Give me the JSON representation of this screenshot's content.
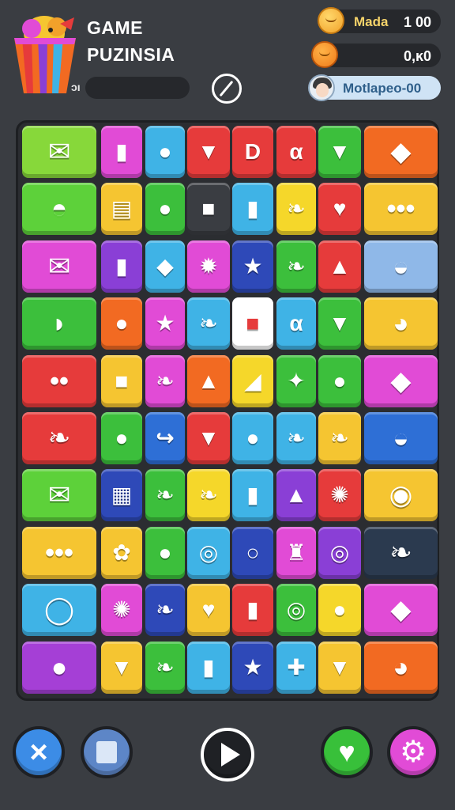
{
  "header": {
    "title_line1": "GAME",
    "title_line2": "PUZINSIA",
    "progress_label": "ɔı",
    "progress_fraction": 0.0,
    "stat1": {
      "name": "Mada",
      "value": "1 00"
    },
    "stat2": {
      "value": "0,ĸ0"
    },
    "player": {
      "name": "Motlapeo-00"
    }
  },
  "board": {
    "rows": [
      [
        {
          "icon": "red-envelope-icon",
          "glyph": "✉",
          "color": "#87d83a",
          "big": true
        },
        {
          "icon": "trash-can-icon",
          "glyph": "▮",
          "color": "#e14bd6"
        },
        {
          "icon": "potion-icon",
          "glyph": "●",
          "color": "#3fb3e6"
        },
        {
          "icon": "ice-cream-cone-icon",
          "glyph": "▼",
          "color": "#e63b3b"
        },
        {
          "icon": "letter-d-icon",
          "glyph": "D",
          "color": "#e63b3b"
        },
        {
          "icon": "letter-a-icon",
          "glyph": "α",
          "color": "#e63b3b"
        },
        {
          "icon": "cone-icon",
          "glyph": "▼",
          "color": "#3cbf3c"
        },
        {
          "icon": "blue-gem-block-icon",
          "glyph": "◆",
          "color": "#f26a22",
          "big": true
        }
      ],
      [
        {
          "icon": "dome-icon",
          "glyph": "◓",
          "color": "#5dd13a",
          "big": true
        },
        {
          "icon": "flag-card-icon",
          "glyph": "▤",
          "color": "#f5c531"
        },
        {
          "icon": "balloon-icon",
          "glyph": "●",
          "color": "#3cbf3c"
        },
        {
          "icon": "blue-cup-icon",
          "glyph": "■",
          "color": "#3a3d42"
        },
        {
          "icon": "yellow-jar-icon",
          "glyph": "▮",
          "color": "#3fb3e6"
        },
        {
          "icon": "purple-leaf-icon",
          "glyph": "❧",
          "color": "#f5d72a"
        },
        {
          "icon": "heart-icon",
          "glyph": "♥",
          "color": "#e63b3b"
        },
        {
          "icon": "yellow-blob-icon",
          "glyph": "•••",
          "color": "#f5c531",
          "big": true
        }
      ],
      [
        {
          "icon": "pink-envelope-icon",
          "glyph": "✉",
          "color": "#e14bd6",
          "big": true
        },
        {
          "icon": "bottle-icon",
          "glyph": "▮",
          "color": "#8a3fd6"
        },
        {
          "icon": "crystal-icon",
          "glyph": "◆",
          "color": "#3fb3e6"
        },
        {
          "icon": "sun-icon",
          "glyph": "✹",
          "color": "#e14bd6"
        },
        {
          "icon": "star-icon",
          "glyph": "★",
          "color": "#2e49b8"
        },
        {
          "icon": "feather-icon",
          "glyph": "❧",
          "color": "#3cbf3c"
        },
        {
          "icon": "rocket-icon",
          "glyph": "▲",
          "color": "#e63b3b"
        },
        {
          "icon": "blue-fish-icon",
          "glyph": "◒",
          "color": "#8fb8e8",
          "big": true
        }
      ],
      [
        {
          "icon": "red-pig-icon",
          "glyph": "◗",
          "color": "#3cbf3c",
          "big": true
        },
        {
          "icon": "lemon-icon",
          "glyph": "●",
          "color": "#f26a22"
        },
        {
          "icon": "star-icon",
          "glyph": "★",
          "color": "#e14bd6"
        },
        {
          "icon": "green-leaf-icon",
          "glyph": "❧",
          "color": "#3fb3e6"
        },
        {
          "icon": "red-box-icon",
          "glyph": "■",
          "color": "#ffffff"
        },
        {
          "icon": "letter-a-icon",
          "glyph": "α",
          "color": "#3fb3e6"
        },
        {
          "icon": "cone-icon",
          "glyph": "▼",
          "color": "#3cbf3c"
        },
        {
          "icon": "orange-cat-icon",
          "glyph": "◕",
          "color": "#f5c531",
          "big": true
        }
      ],
      [
        {
          "icon": "orange-blob-icon",
          "glyph": "••",
          "color": "#e63b3b",
          "big": true
        },
        {
          "icon": "green-bag-icon",
          "glyph": "■",
          "color": "#f5c531"
        },
        {
          "icon": "pink-leaf-icon",
          "glyph": "❧",
          "color": "#e14bd6"
        },
        {
          "icon": "paper-plane-icon",
          "glyph": "▲",
          "color": "#f26a22"
        },
        {
          "icon": "white-sail-icon",
          "glyph": "◢",
          "color": "#f5d72a"
        },
        {
          "icon": "green-star-icon",
          "glyph": "✦",
          "color": "#3cbf3c"
        },
        {
          "icon": "purple-drop-icon",
          "glyph": "●",
          "color": "#3cbf3c"
        },
        {
          "icon": "purple-gem-block-icon",
          "glyph": "◆",
          "color": "#e14bd6",
          "big": true
        }
      ],
      [
        {
          "icon": "blue-bird-icon",
          "glyph": "❧",
          "color": "#e63b3b",
          "big": true
        },
        {
          "icon": "blue-coin-icon",
          "glyph": "●",
          "color": "#3cbf3c"
        },
        {
          "icon": "yellow-hook-icon",
          "glyph": "↪",
          "color": "#2e6fd6"
        },
        {
          "icon": "ice-cream-cone-icon",
          "glyph": "▼",
          "color": "#e63b3b"
        },
        {
          "icon": "pink-ball-icon",
          "glyph": "●",
          "color": "#3fb3e6"
        },
        {
          "icon": "purple-leaf-icon",
          "glyph": "❧",
          "color": "#3fb3e6"
        },
        {
          "icon": "purple-feather-icon",
          "glyph": "❧",
          "color": "#f5c531"
        },
        {
          "icon": "blue-whale-icon",
          "glyph": "◒",
          "color": "#2e6fd6",
          "big": true
        }
      ],
      [
        {
          "icon": "purple-envelope-icon",
          "glyph": "✉",
          "color": "#5dd13a",
          "big": true
        },
        {
          "icon": "red-card-icon",
          "glyph": "▦",
          "color": "#2e49b8"
        },
        {
          "icon": "green-leaf-icon",
          "glyph": "❧",
          "color": "#3cbf3c"
        },
        {
          "icon": "green-leaf-icon",
          "glyph": "❧",
          "color": "#f5d72a"
        },
        {
          "icon": "white-jar-icon",
          "glyph": "▮",
          "color": "#3fb3e6"
        },
        {
          "icon": "paper-plane-icon",
          "glyph": "▲",
          "color": "#8a3fd6"
        },
        {
          "icon": "pink-urchin-icon",
          "glyph": "✺",
          "color": "#e63b3b"
        },
        {
          "icon": "white-robot-icon",
          "glyph": "◉",
          "color": "#f5c531",
          "big": true
        }
      ],
      [
        {
          "icon": "yellow-blob-icon",
          "glyph": "•••",
          "color": "#f5c531",
          "big": true
        },
        {
          "icon": "green-cactus-icon",
          "glyph": "✿",
          "color": "#f5c531"
        },
        {
          "icon": "purple-balloon-icon",
          "glyph": "●",
          "color": "#3cbf3c"
        },
        {
          "icon": "blue-ring-icon",
          "glyph": "◎",
          "color": "#3fb3e6"
        },
        {
          "icon": "gold-ring-icon",
          "glyph": "○",
          "color": "#2e49b8"
        },
        {
          "icon": "yellow-crown-icon",
          "glyph": "♜",
          "color": "#e14bd6"
        },
        {
          "icon": "blue-donut-icon",
          "glyph": "◎",
          "color": "#8a3fd6"
        },
        {
          "icon": "green-leaf-icon",
          "glyph": "❧",
          "color": "#2b3a4f",
          "big": true
        }
      ],
      [
        {
          "icon": "gold-ring-icon",
          "glyph": "◯",
          "color": "#3fb3e6",
          "big": true
        },
        {
          "icon": "purple-urchin-icon",
          "glyph": "✺",
          "color": "#e14bd6"
        },
        {
          "icon": "red-leaf-icon",
          "glyph": "❧",
          "color": "#2e49b8"
        },
        {
          "icon": "red-heart-leaf-icon",
          "glyph": "♥",
          "color": "#f5c531"
        },
        {
          "icon": "pink-jar-icon",
          "glyph": "▮",
          "color": "#e63b3b"
        },
        {
          "icon": "blue-pin-icon",
          "glyph": "◎",
          "color": "#3cbf3c"
        },
        {
          "icon": "pink-drop-icon",
          "glyph": "●",
          "color": "#f5d72a"
        },
        {
          "icon": "pink-gem-icon",
          "glyph": "◆",
          "color": "#e14bd6",
          "big": true
        }
      ],
      [
        {
          "icon": "red-donut-icon",
          "glyph": "●",
          "color": "#a53fd6",
          "big": true
        },
        {
          "icon": "pink-cup-icon",
          "glyph": "▼",
          "color": "#f5c531"
        },
        {
          "icon": "orange-leaf-icon",
          "glyph": "❧",
          "color": "#3cbf3c"
        },
        {
          "icon": "blue-trash-icon",
          "glyph": "▮",
          "color": "#3fb3e6"
        },
        {
          "icon": "star-icon",
          "glyph": "★",
          "color": "#2e49b8"
        },
        {
          "icon": "blue-cross-icon",
          "glyph": "✚",
          "color": "#3fb3e6"
        },
        {
          "icon": "pencil-icon",
          "glyph": "▼",
          "color": "#f5c531"
        },
        {
          "icon": "orange-cat-icon",
          "glyph": "◕",
          "color": "#f26a22",
          "big": true
        }
      ]
    ]
  },
  "bottom_bar": {
    "close_icon": "×",
    "heart_icon": "♥",
    "gear_icon": "⚙"
  },
  "colors": {
    "background": "#3a3d42",
    "board": "#2b2d31",
    "pill": "#26282c",
    "player_pill": "#cfe3f5"
  }
}
